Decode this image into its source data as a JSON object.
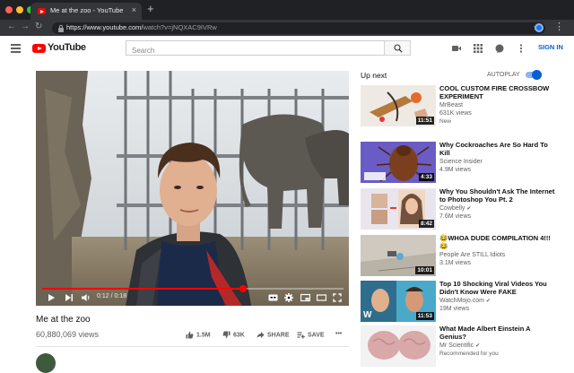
{
  "browser": {
    "tab_title": "Me at the zoo - YouTube",
    "tab_close": "×",
    "new_tab": "+",
    "url_host": "https://www.youtube.com/",
    "url_path": "watch?v=jNQXAC9IVRw",
    "colors": {
      "tab_bar": "#202124",
      "toolbar": "#35363a"
    }
  },
  "masthead": {
    "logo_text": "YouTube",
    "search_placeholder": "Search",
    "signin_label": "SIGN IN",
    "icons": [
      "menu-icon",
      "youtube-logo-icon",
      "search-icon",
      "create-video-icon",
      "apps-grid-icon",
      "messages-icon",
      "settings-dots-icon"
    ],
    "brand_color": "#ff0000",
    "link_color": "#065fd4"
  },
  "player": {
    "time_current": "0:12",
    "time_separator": "/",
    "time_total": "0:18",
    "progress_fraction": 0.667,
    "controls": [
      "play-icon",
      "next-icon",
      "volume-icon",
      "captions-icon",
      "settings-icon",
      "miniplayer-icon",
      "theater-icon",
      "fullscreen-icon"
    ]
  },
  "video": {
    "title": "Me at the zoo",
    "views": "60,880,069 views",
    "likes": "1.5M",
    "dislikes": "63K",
    "share_label": "SHARE",
    "save_label": "SAVE",
    "more_label": "•••"
  },
  "upnext": {
    "heading": "Up next",
    "autoplay_label": "AUTOPLAY",
    "autoplay_on": true,
    "items": [
      {
        "title": "COOL CUSTOM FIRE CROSSBOW EXPERIMENT",
        "channel": "MrBeast",
        "views": "631K views",
        "badge": "New",
        "duration": "11:51",
        "thumb_color": "#efe9e4"
      },
      {
        "title": "Why Cockroaches Are So Hard To Kill",
        "channel": "Science Insider",
        "views": "4.9M views",
        "badge": "",
        "duration": "4:33",
        "thumb_color": "#6a5cc4"
      },
      {
        "title": "Why You Shouldn't Ask The Internet to Photoshop You Pt. 2",
        "channel": "Cowbelly",
        "views": "7.6M views",
        "badge": "",
        "duration": "8:42",
        "thumb_color": "#e9e5ee"
      },
      {
        "title": "😂WHOA DUDE COMPILATION 4!!!😂",
        "channel": "People Are STILL Idiots",
        "views": "3.1M views",
        "badge": "",
        "duration": "10:01",
        "thumb_color": "#cfc9bf"
      },
      {
        "title": "Top 10 Shocking Viral Videos You Didn't Know Were FAKE",
        "channel": "WatchMojo.com",
        "views": "19M views",
        "badge": "",
        "duration": "11:53",
        "thumb_color": "#4aa9c9"
      },
      {
        "title": "What Made Albert Einstein A Genius?",
        "channel": "Mr Scientific",
        "views": "",
        "badge": "Recommended for you",
        "duration": "",
        "thumb_color": "#d9a8a8"
      }
    ]
  }
}
